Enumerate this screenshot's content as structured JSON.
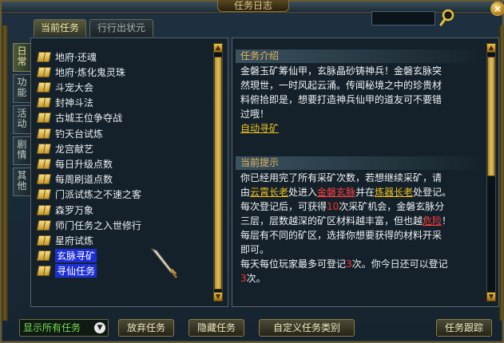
{
  "window": {
    "title": "任务日志",
    "close_symbol": "×"
  },
  "tabs": [
    {
      "label": "当前任务",
      "active": true
    },
    {
      "label": "行行出状元",
      "active": false
    }
  ],
  "categories": [
    {
      "label": "日常",
      "active": true
    },
    {
      "label": "功能",
      "active": false
    },
    {
      "label": "活动",
      "active": false
    },
    {
      "label": "剧情",
      "active": false
    },
    {
      "label": "其他",
      "active": false
    }
  ],
  "quests": [
    {
      "label": "地府·还魂",
      "selected": false
    },
    {
      "label": "地府·炼化鬼灵珠",
      "selected": false
    },
    {
      "label": "斗宠大会",
      "selected": false
    },
    {
      "label": "封神斗法",
      "selected": false
    },
    {
      "label": "古城王位争夺战",
      "selected": false
    },
    {
      "label": "钓天台试炼",
      "selected": false
    },
    {
      "label": "龙宫献艺",
      "selected": false
    },
    {
      "label": "每日升级点数",
      "selected": false
    },
    {
      "label": "每周刷道点数",
      "selected": false
    },
    {
      "label": "门派试炼之不速之客",
      "selected": false
    },
    {
      "label": "森罗万象",
      "selected": false
    },
    {
      "label": "师门任务之入世修行",
      "selected": false
    },
    {
      "label": "星府试炼",
      "selected": false
    },
    {
      "label": "玄脉寻矿",
      "selected": true
    },
    {
      "label": "寻仙任务",
      "selected": true
    }
  ],
  "detail": {
    "intro_header": "任务介绍",
    "intro_lines": [
      "金磐玉矿筹仙甲，玄脉晶砂铸神兵！金磐玄脉突",
      "然現世，一时风起云涌。传闻秘境之中的珍贵材",
      "料俯拾即是，想要打造神兵仙甲的道友可不要错",
      "过哦！"
    ],
    "auto_link": "自动寻矿",
    "hint_header": "当前提示",
    "hint_p1_a": "你已经用完了所有采矿次数，若想继续采矿，请",
    "hint_p1_b": "由",
    "hint_npc1": "云霄长老",
    "hint_p1_c": "处进入",
    "hint_place": "金磐玄脉",
    "hint_p1_d": "并在",
    "hint_npc2": "炼器长老",
    "hint_p1_e": "处登记。",
    "hint_p2_a": "每次登记后，可获得",
    "hint_p2_num": "10",
    "hint_p2_b": "次采矿机会，金磐玄脉分",
    "hint_p2_c": "三层，层数越深的矿区材料越丰富，但也越",
    "hint_danger": "危险",
    "hint_p2_d": "！",
    "hint_p3_a": "每层有不同的矿区，选择你想要获得的材料开采",
    "hint_p3_b": "即可。",
    "hint_p4_a": "每天每位玩家最多可登记",
    "hint_p4_num1": "3",
    "hint_p4_b": "次。你今日还可以登记",
    "hint_p4_num2": "3",
    "hint_p4_c": "次。"
  },
  "bottom": {
    "filter_label": "显示所有任务",
    "abandon": "放弃任务",
    "hide": "隐藏任务",
    "custom": "自定义任务类别",
    "track": "任务跟踪"
  },
  "colors": {
    "accent_gold": "#e7b95a",
    "selected_bg": "#1c2fd6",
    "warning_red": "#ff3030",
    "filter_green": "#76e04a"
  }
}
